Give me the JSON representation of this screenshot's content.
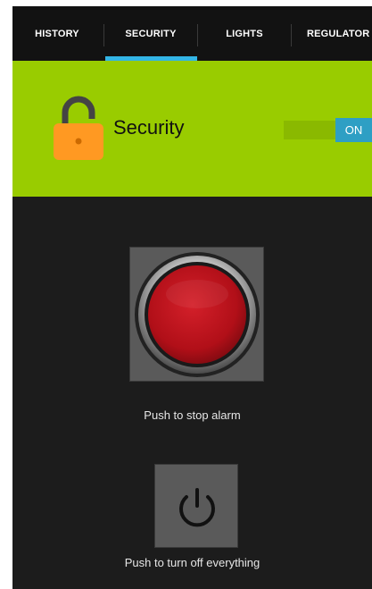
{
  "tabs": [
    {
      "label": "HISTORY"
    },
    {
      "label": "SECURITY",
      "selected": true
    },
    {
      "label": "LIGHTS"
    },
    {
      "label": "REGULATOR"
    }
  ],
  "security": {
    "label": "Security",
    "toggle_state": "ON",
    "lock_icon": "unlocked-padlock-icon"
  },
  "alarm": {
    "caption": "Push to stop alarm",
    "icon": "red-push-button-icon"
  },
  "power": {
    "caption": "Push to turn off everything",
    "icon": "power-icon"
  },
  "colors": {
    "accent": "#33b5e5",
    "panel": "#99cc00",
    "lock": "#ff9922",
    "toggle_on": "#2e9fc4",
    "alarm_red": "#b8121a"
  }
}
